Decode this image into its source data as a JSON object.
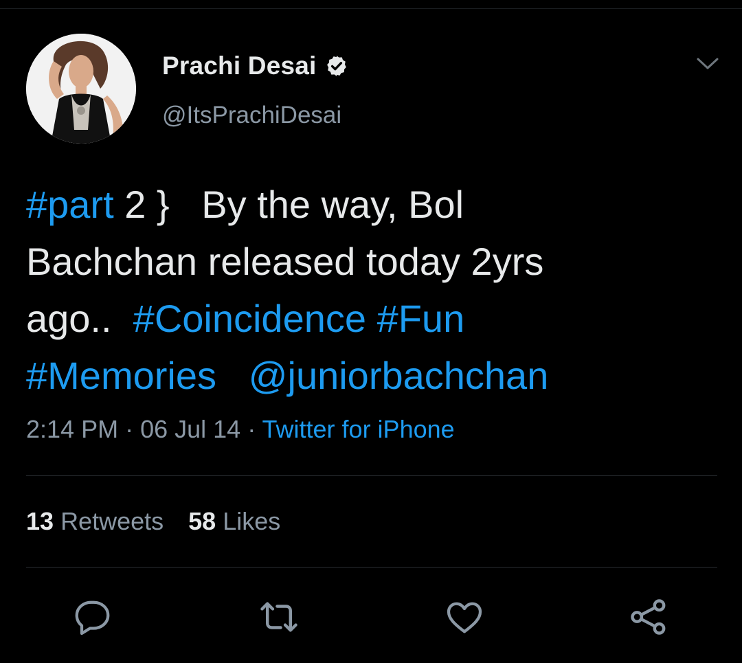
{
  "tweet": {
    "author": {
      "display_name": "Prachi Desai",
      "handle": "@ItsPrachiDesai",
      "verified": true
    },
    "text_lines": [
      [
        {
          "text": "#part",
          "kind": "hashtag"
        },
        {
          "text": " 2 }   By the way, Bol",
          "kind": "text"
        }
      ],
      [
        {
          "text": "Bachchan released today 2yrs",
          "kind": "text"
        }
      ],
      [
        {
          "text": "ago..  ",
          "kind": "text"
        },
        {
          "text": "#Coincidence",
          "kind": "hashtag"
        },
        {
          "text": " ",
          "kind": "text"
        },
        {
          "text": "#Fun",
          "kind": "hashtag"
        }
      ],
      [
        {
          "text": "#Memories",
          "kind": "hashtag"
        },
        {
          "text": "   ",
          "kind": "text"
        },
        {
          "text": "@juniorbachchan",
          "kind": "mention"
        }
      ]
    ],
    "time": "2:14 PM",
    "date": "06 Jul 14",
    "separator": " · ",
    "source": "Twitter for iPhone"
  },
  "stats": {
    "retweets_count": "13",
    "retweets_label": "Retweets",
    "likes_count": "58",
    "likes_label": "Likes"
  },
  "actions": [
    {
      "name": "reply",
      "icon": "reply-icon"
    },
    {
      "name": "retweet",
      "icon": "retweet-icon"
    },
    {
      "name": "like",
      "icon": "heart-icon"
    },
    {
      "name": "share",
      "icon": "share-icon"
    }
  ],
  "colors": {
    "background": "#000000",
    "text": "#e7e9ea",
    "secondary": "#8b98a5",
    "accent": "#1d9bf0",
    "divider": "#2a2f33"
  }
}
